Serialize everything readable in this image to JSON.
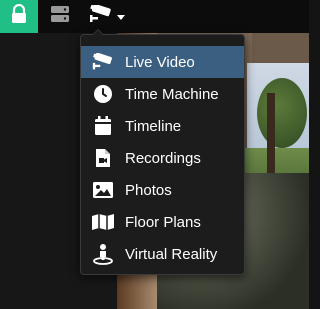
{
  "toolbar": {
    "buttons": [
      {
        "icon": "lock-icon",
        "accent": "#1fbf86"
      },
      {
        "icon": "server-icon"
      },
      {
        "icon": "security-camera-icon",
        "has_dropdown": true
      }
    ]
  },
  "menu": {
    "items": [
      {
        "label": "Live Video",
        "icon": "security-camera-icon",
        "selected": true
      },
      {
        "label": "Time Machine",
        "icon": "clock-icon"
      },
      {
        "label": "Timeline",
        "icon": "calendar-icon"
      },
      {
        "label": "Recordings",
        "icon": "video-file-icon"
      },
      {
        "label": "Photos",
        "icon": "image-icon"
      },
      {
        "label": "Floor Plans",
        "icon": "map-icon"
      },
      {
        "label": "Virtual Reality",
        "icon": "vr-person-icon"
      }
    ],
    "selected_color": "#3a5f80"
  }
}
